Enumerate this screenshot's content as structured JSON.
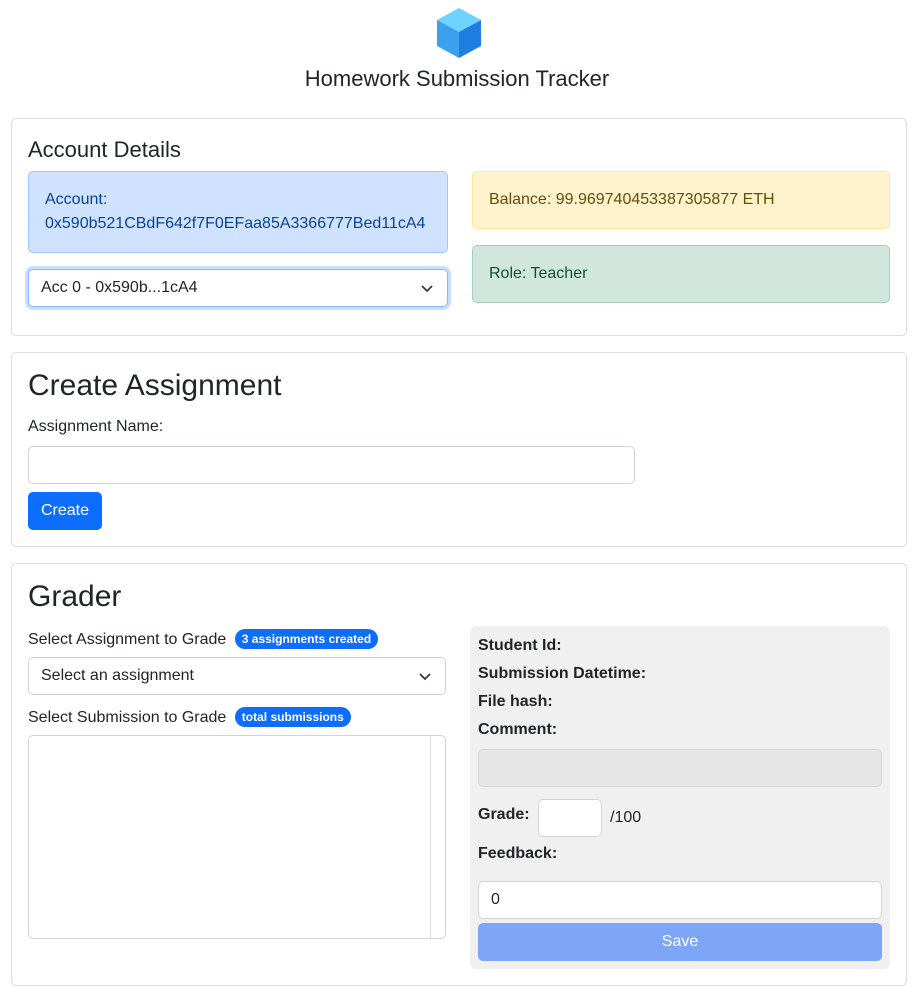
{
  "app": {
    "title": "Homework Submission Tracker"
  },
  "account": {
    "heading": "Account Details",
    "account_label": "Account:",
    "account_address": "0x590b521CBdF642f7F0EFaa85A3366777Bed11cA4",
    "selected_account": "Acc 0 - 0x590b...1cA4",
    "balance": "Balance: 99.969740453387305877 ETH",
    "role": "Role: Teacher"
  },
  "create": {
    "heading": "Create Assignment",
    "name_label": "Assignment Name:",
    "name_value": "",
    "button": "Create"
  },
  "grader": {
    "heading": "Grader",
    "select_assignment_label": "Select Assignment to Grade",
    "assignments_badge": "3 assignments created",
    "assignment_placeholder": "Select an assignment",
    "select_submission_label": "Select Submission to Grade",
    "submissions_badge": "total submissions",
    "details": {
      "student_id_label": "Student Id:",
      "datetime_label": "Submission Datetime:",
      "file_hash_label": "File hash:",
      "comment_label": "Comment:",
      "grade_label": "Grade:",
      "grade_max": "/100",
      "feedback_label": "Feedback:",
      "feedback_value": "0",
      "save_button": "Save"
    }
  },
  "colors": {
    "primary": "#0d6efd",
    "info_bg": "#cfe2ff",
    "warning_bg": "#fff3cd",
    "success_bg": "#d1e7dd"
  },
  "icons": {
    "logo": "cube-logo-icon",
    "caret": "chevron-down-icon"
  }
}
